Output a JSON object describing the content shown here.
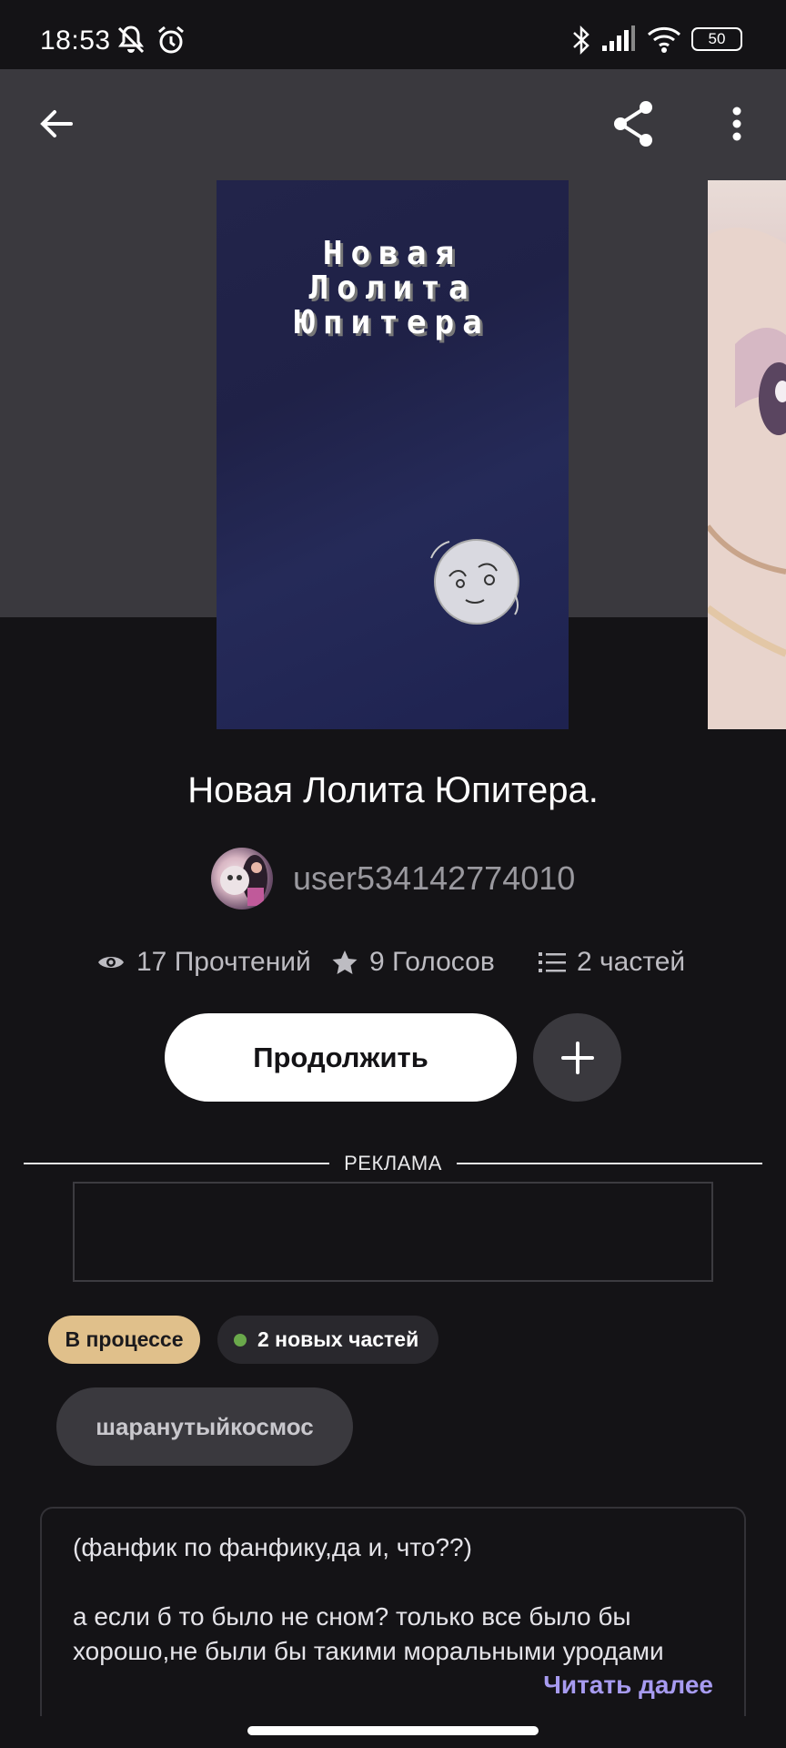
{
  "status_bar": {
    "time": "18:53",
    "battery": "50"
  },
  "book": {
    "cover_title_lines": [
      "Новая",
      "Лолита",
      "Юпитера"
    ],
    "title": "Новая Лолита Юпитера.",
    "author": "user534142774010",
    "stats": {
      "reads": "17 Прочтений",
      "votes": "9 Голосов",
      "parts": "2 частей"
    }
  },
  "actions": {
    "continue_label": "Продолжить"
  },
  "ad": {
    "label": "РЕКЛАМА"
  },
  "badges": {
    "status": "В процессе",
    "new_parts": "2 новых частей"
  },
  "tags": [
    "шаранутыйкосмос"
  ],
  "description": {
    "line1": "(фанфик по фанфику,да и, что??)",
    "line2": "а если б то было не сном? только все было бы хорошо,не были бы такими моральными уродами",
    "read_more": "Читать далее"
  },
  "colors": {
    "background": "#141316",
    "header_bg": "#3a393e",
    "status_badge": "#e0c08b",
    "accent_link": "#a79bf0",
    "new_dot": "#6aa94b"
  }
}
